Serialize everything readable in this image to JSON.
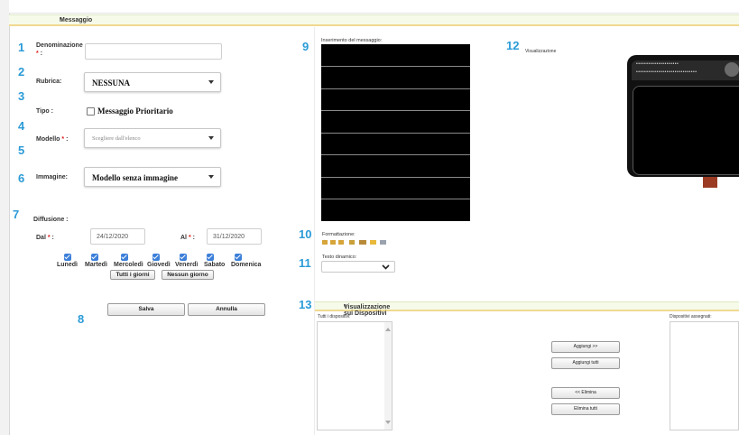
{
  "section_title": "Messaggio",
  "section_required": "*",
  "step_numbers": [
    "1",
    "2",
    "3",
    "4",
    "5",
    "6",
    "7",
    "8",
    "9",
    "10",
    "11",
    "12",
    "13"
  ],
  "form": {
    "denominazione_label": "Denominazione",
    "denominazione_req": "*",
    "denominazione_suffix": ":",
    "denominazione_value": "",
    "rubrica_label": "Rubrica:",
    "rubrica_value": "NESSUNA",
    "tipo_label": "Tipo :",
    "tipo_checkbox_label": "Messaggio Prioritario",
    "modello_label": "Modello",
    "modello_req": "*",
    "modello_suffix": ":",
    "modello_placeholder": "Scegliere dall'elenco",
    "immagine_label": "Immagine:",
    "immagine_value": "Modello senza immagine",
    "diffusione_label": "Diffusione :",
    "dal_label": "Dal",
    "dal_req": "*",
    "dal_suffix": ":",
    "dal_value": "24/12/2020",
    "al_label": "Al",
    "al_req": "*",
    "al_suffix": ":",
    "al_value": "31/12/2020",
    "days": [
      "Lunedì",
      "Martedì",
      "Mercoledì",
      "Giovedì",
      "Venerdì",
      "Sabato",
      "Domenica"
    ],
    "tutti_giorni": "Tutti i giorni",
    "nessun_giorno": "Nessun giorno",
    "salva": "Salva",
    "annulla": "Annulla"
  },
  "editor": {
    "inserimento_label": "Inserimento del messaggio:",
    "formattazione_label": "Formattazione:",
    "testo_dinamico_label": "Testo dinamico:"
  },
  "preview": {
    "label": "Visualizzazione",
    "led_dots": "•••••••••••••••••••••",
    "led_dots2": "••••••••••••••••••••••••••••••"
  },
  "devices": {
    "section_title": "Visualizzazione sui Dispositivi",
    "section_required": "*",
    "tutti_label": "Tutti i dispositivi:",
    "assegnati_label": "Dispositivi assegnati:",
    "aggiungi": "Aggiungi >>",
    "aggiungi_tutti": "Aggiungi tutti",
    "elimina": "<< Elimina",
    "elimina_tutti": "Elimina tutti"
  },
  "colors": {
    "accent_number": "#2b9bd7",
    "required": "#e01b1b",
    "checkbox": "#3c7fd8"
  }
}
